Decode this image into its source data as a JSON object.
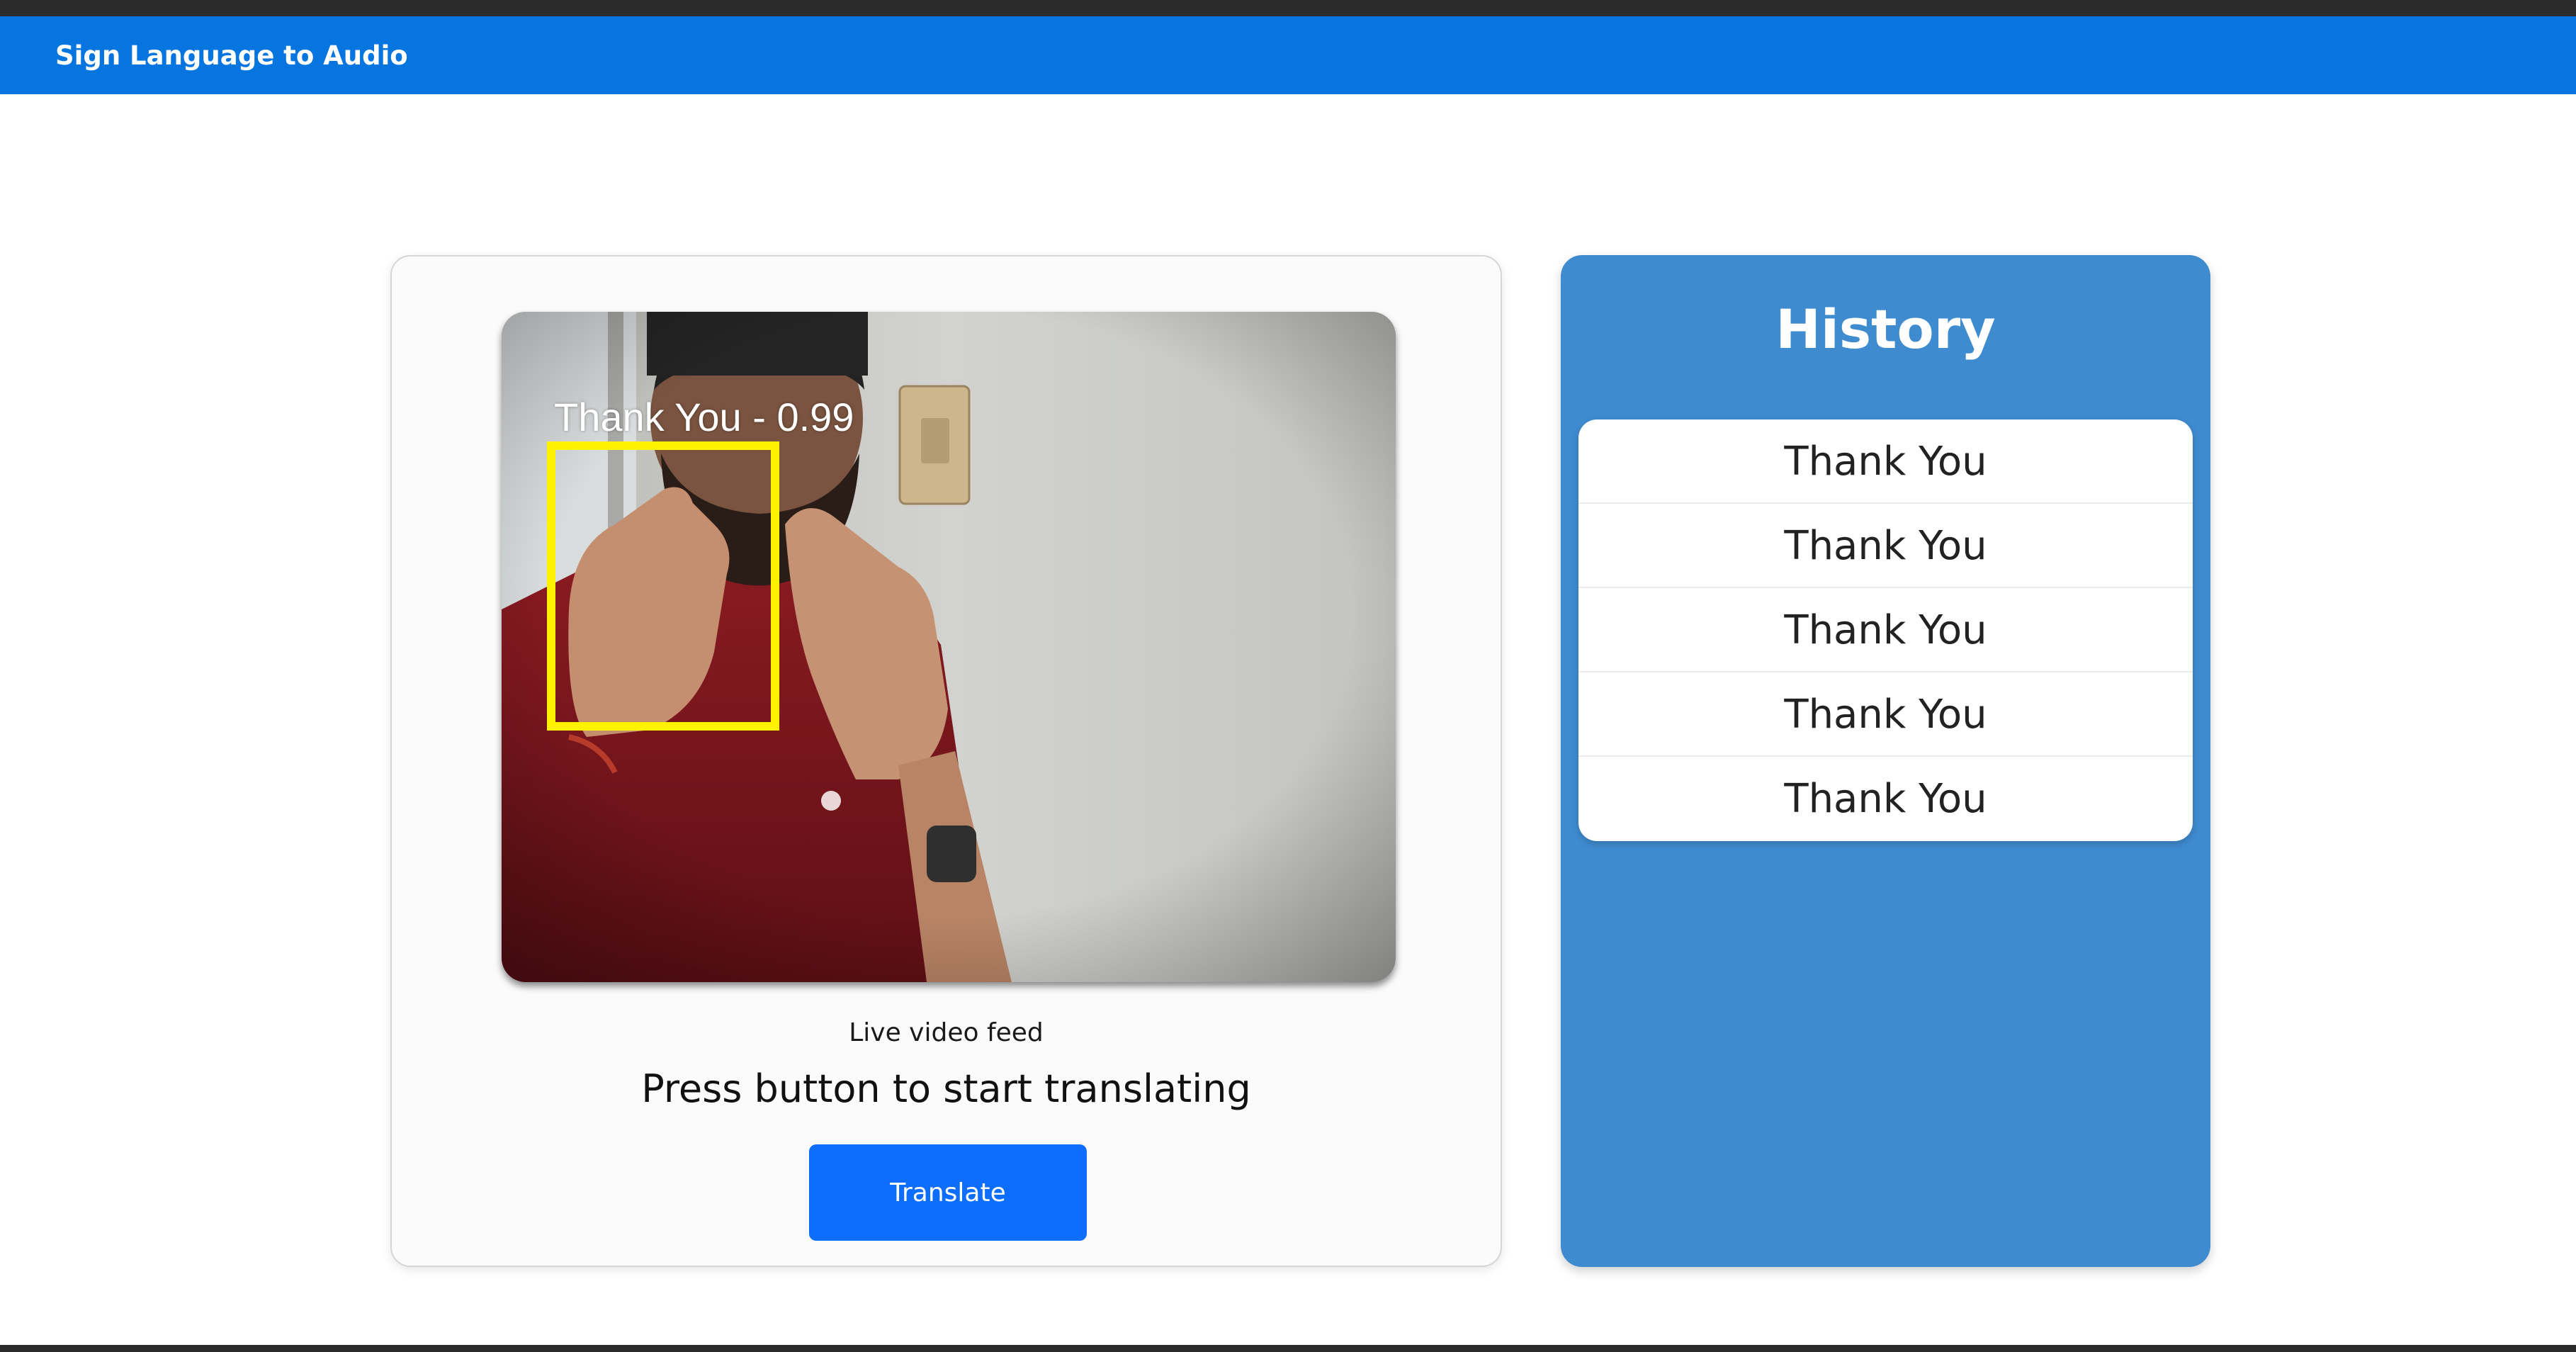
{
  "navbar": {
    "brand": "Sign Language to Audio"
  },
  "video": {
    "detection_label": "Thank You - 0.99",
    "caption": "Live video feed"
  },
  "status": "Press button to start translating",
  "translate_button": {
    "label": "Translate"
  },
  "history": {
    "title": "History",
    "items": [
      "Thank You",
      "Thank You",
      "Thank You",
      "Thank You",
      "Thank You"
    ]
  },
  "colors": {
    "navbar": "#0675e0",
    "history_panel": "#3f8bd0",
    "button": "#0d6efd",
    "detection_box": "#fff200"
  }
}
